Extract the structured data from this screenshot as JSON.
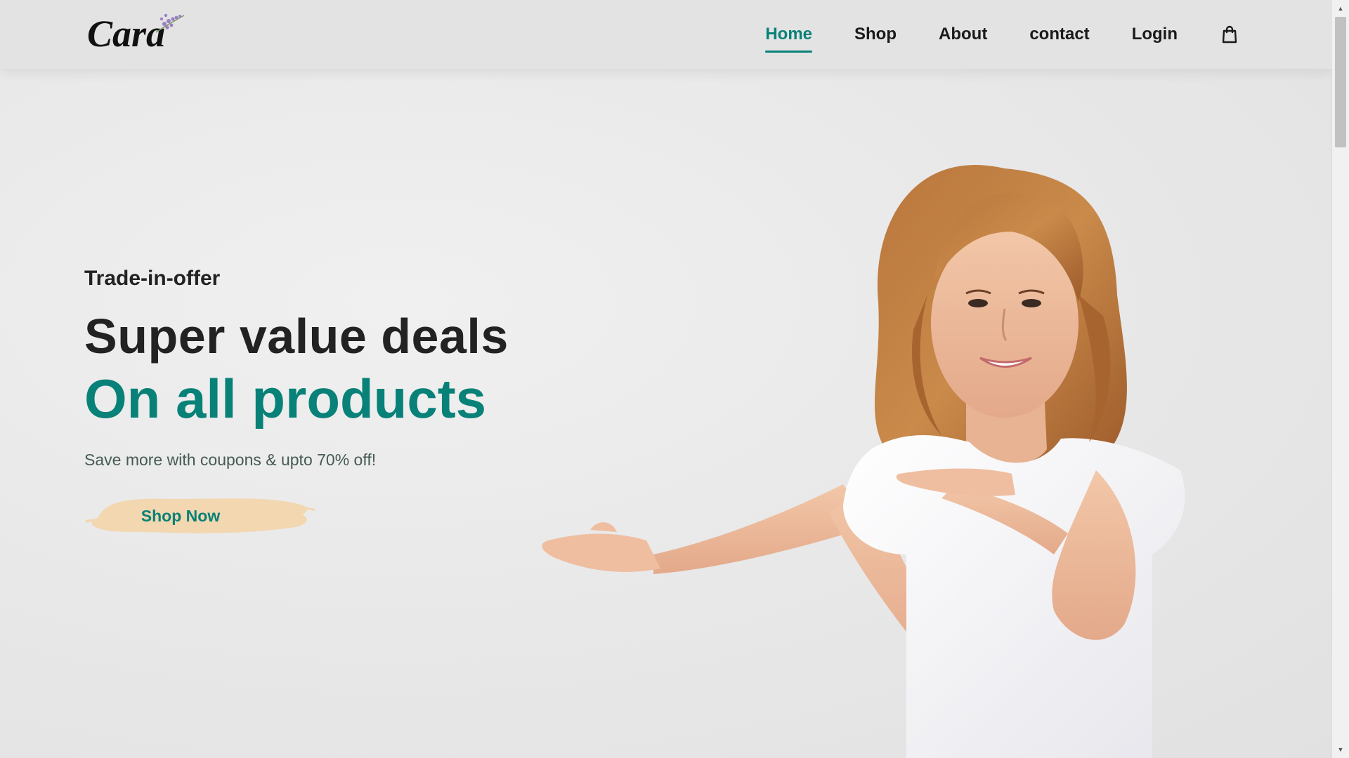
{
  "brand": {
    "logo_text": "Cara"
  },
  "nav": {
    "items": [
      {
        "label": "Home",
        "active": true
      },
      {
        "label": "Shop",
        "active": false
      },
      {
        "label": "About",
        "active": false
      },
      {
        "label": "contact",
        "active": false
      },
      {
        "label": "Login",
        "active": false
      }
    ],
    "cart_icon": "shopping-bag-icon"
  },
  "hero": {
    "kicker": "Trade-in-offer",
    "title_line1": "Super value deals",
    "title_line2": "On all products",
    "subtitle": "Save more with coupons & upto 70% off!",
    "cta_label": "Shop Now"
  },
  "colors": {
    "accent": "#088178",
    "text_dark": "#222222",
    "button_brush": "#f2d7b0",
    "background": "#e6e6e6"
  }
}
